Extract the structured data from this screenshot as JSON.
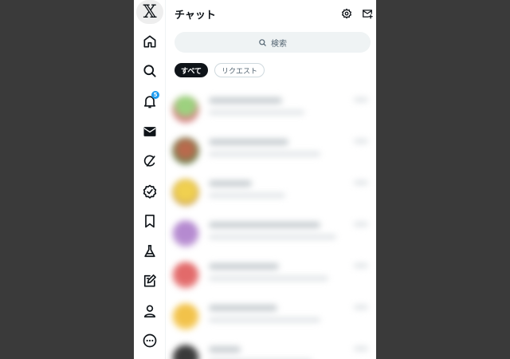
{
  "sidebar": {
    "logo": "𝕏",
    "notification_count": "5",
    "items": [
      {
        "icon": "home-icon"
      },
      {
        "icon": "search-icon"
      },
      {
        "icon": "bell-icon"
      },
      {
        "icon": "mail-icon"
      },
      {
        "icon": "grok-icon"
      },
      {
        "icon": "verified-icon"
      },
      {
        "icon": "bookmark-icon"
      },
      {
        "icon": "flask-icon"
      },
      {
        "icon": "compose-icon"
      },
      {
        "icon": "person-icon"
      },
      {
        "icon": "more-icon"
      }
    ]
  },
  "header": {
    "title": "チャット",
    "settings_icon": "gear-icon",
    "new_message_icon": "new-message-icon"
  },
  "search": {
    "placeholder": "検索"
  },
  "filters": [
    {
      "label": "すべて",
      "active": true
    },
    {
      "label": "リクエスト",
      "active": false
    }
  ],
  "colors": {
    "accent": "#1d9bf0",
    "text": "#0f1419",
    "muted": "#536471",
    "background": "#3a3a3a"
  }
}
